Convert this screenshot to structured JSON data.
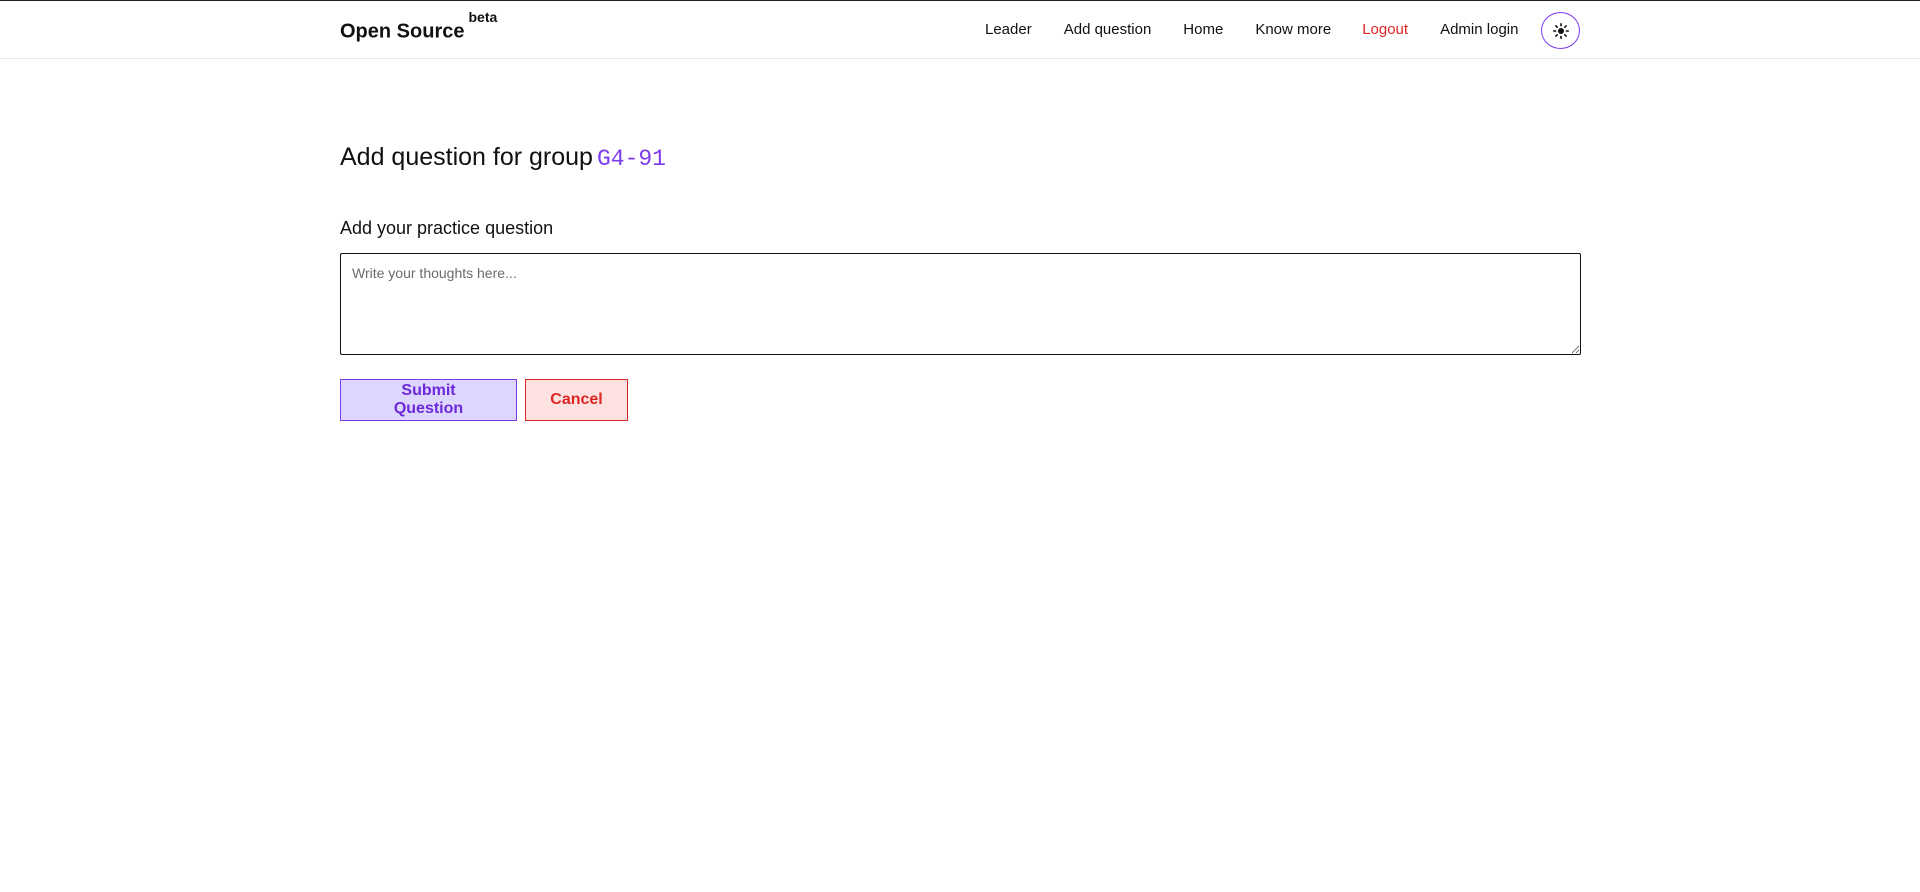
{
  "header": {
    "brand": "Open Source",
    "brand_badge": "beta",
    "nav": {
      "leader": "Leader",
      "add_question": "Add question",
      "home": "Home",
      "know_more": "Know more",
      "logout": "Logout",
      "admin_login": "Admin login"
    },
    "theme_icon": "sun-icon"
  },
  "main": {
    "title_prefix": "Add question for group",
    "group_code": "G4-91",
    "field_label": "Add your practice question",
    "question_value": "",
    "question_placeholder": "Write your thoughts here...",
    "submit_label": "Submit Question",
    "cancel_label": "Cancel"
  },
  "colors": {
    "accent": "#7c3aed",
    "danger": "#dc2626",
    "submit_bg": "#ddd6fe",
    "cancel_bg": "#fee2e2"
  }
}
